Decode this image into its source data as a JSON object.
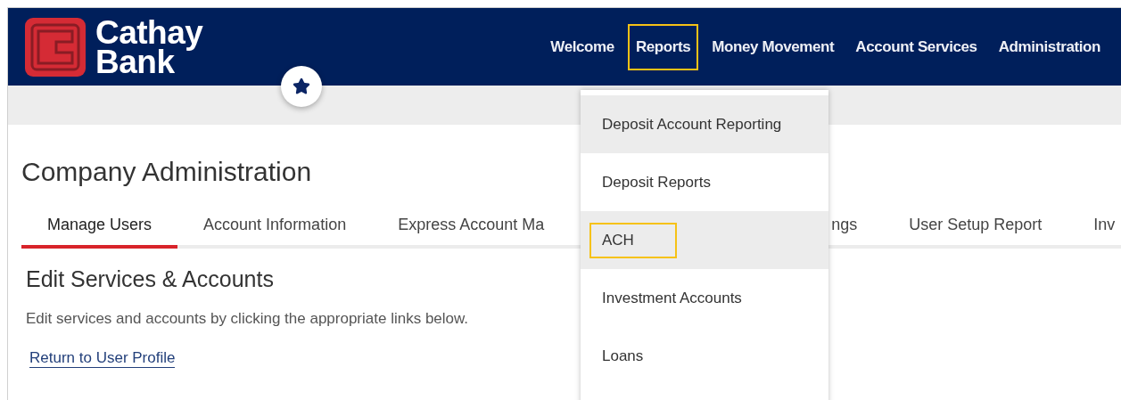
{
  "logo": {
    "line_1": "Cathay",
    "line_2": "Bank"
  },
  "nav": [
    {
      "label": "Welcome",
      "highlighted": false
    },
    {
      "label": "Reports",
      "highlighted": true
    },
    {
      "label": "Money Movement",
      "highlighted": false
    },
    {
      "label": "Account Services",
      "highlighted": false
    },
    {
      "label": "Administration",
      "highlighted": false
    }
  ],
  "page_title": "Company Administration",
  "tabs": [
    {
      "label": "Manage Users",
      "selected": true
    },
    {
      "label": "Account Information",
      "selected": false
    },
    {
      "label": "Express Account Ma",
      "selected": false
    },
    {
      "label": "ngs",
      "selected": false
    },
    {
      "label": "User Setup Report",
      "selected": false
    },
    {
      "label": "Inv",
      "selected": false
    }
  ],
  "section_title": "Edit Services & Accounts",
  "description": "Edit services and accounts by clicking the appropriate links below.",
  "link": "Return to User Profile",
  "dropdown": {
    "items": [
      {
        "label": "Deposit Account Reporting",
        "shaded": true,
        "highlighted": false
      },
      {
        "label": "Deposit Reports",
        "shaded": false,
        "highlighted": false
      },
      {
        "label": "ACH",
        "shaded": true,
        "highlighted": true
      },
      {
        "label": "Investment Accounts",
        "shaded": false,
        "highlighted": false
      },
      {
        "label": "Loans",
        "shaded": false,
        "highlighted": false
      }
    ]
  }
}
